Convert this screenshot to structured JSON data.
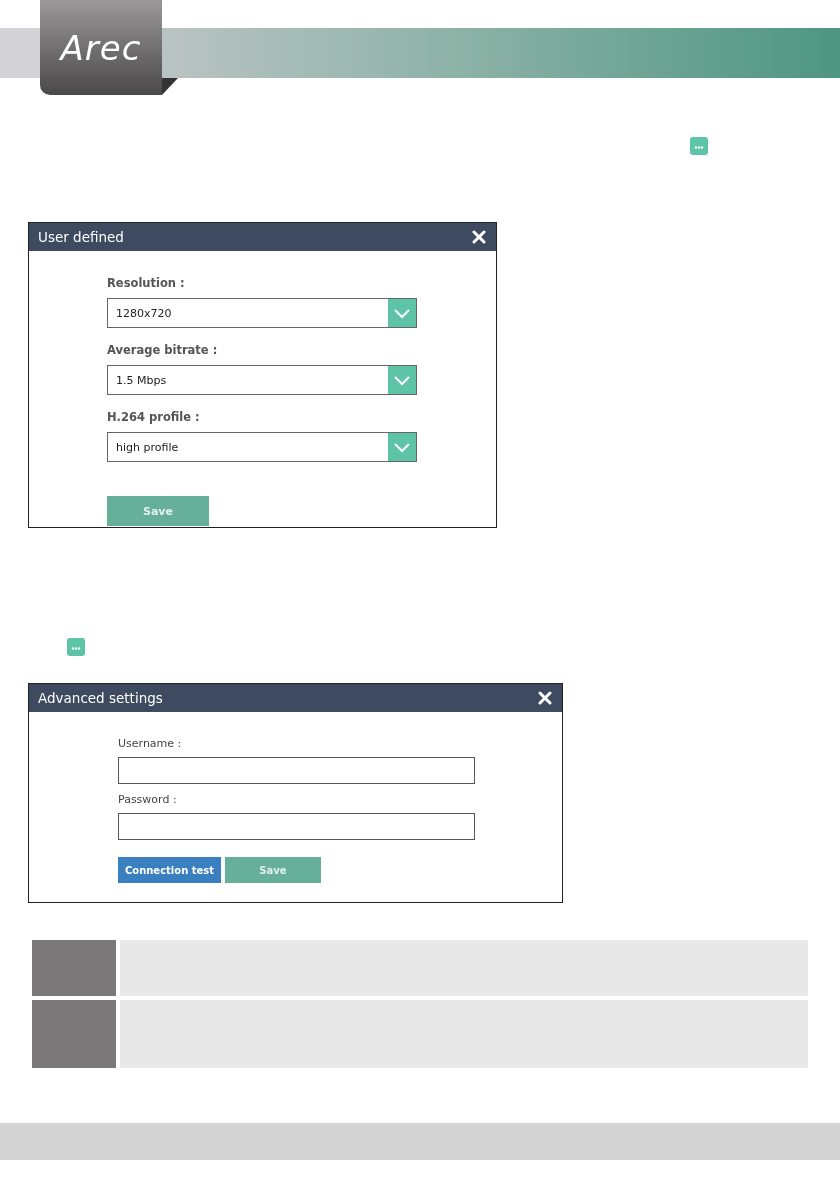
{
  "header": {
    "logo": "Arec"
  },
  "user_defined_dialog": {
    "title": "User defined",
    "fields": [
      {
        "label": "Resolution :",
        "value": "1280x720"
      },
      {
        "label": "Average bitrate :",
        "value": "1.5 Mbps"
      },
      {
        "label": "H.264 profile :",
        "value": "high profile"
      }
    ],
    "save_button": {
      "label": "Save",
      "disabled": true
    }
  },
  "advanced_dialog": {
    "title": "Advanced settings",
    "fields": [
      {
        "label": "Username :"
      },
      {
        "label": "Password :"
      }
    ],
    "buttons": [
      {
        "label": "Connection test",
        "kind": "primary",
        "disabled": false
      },
      {
        "label": "Save",
        "kind": "save",
        "disabled": true
      }
    ]
  }
}
